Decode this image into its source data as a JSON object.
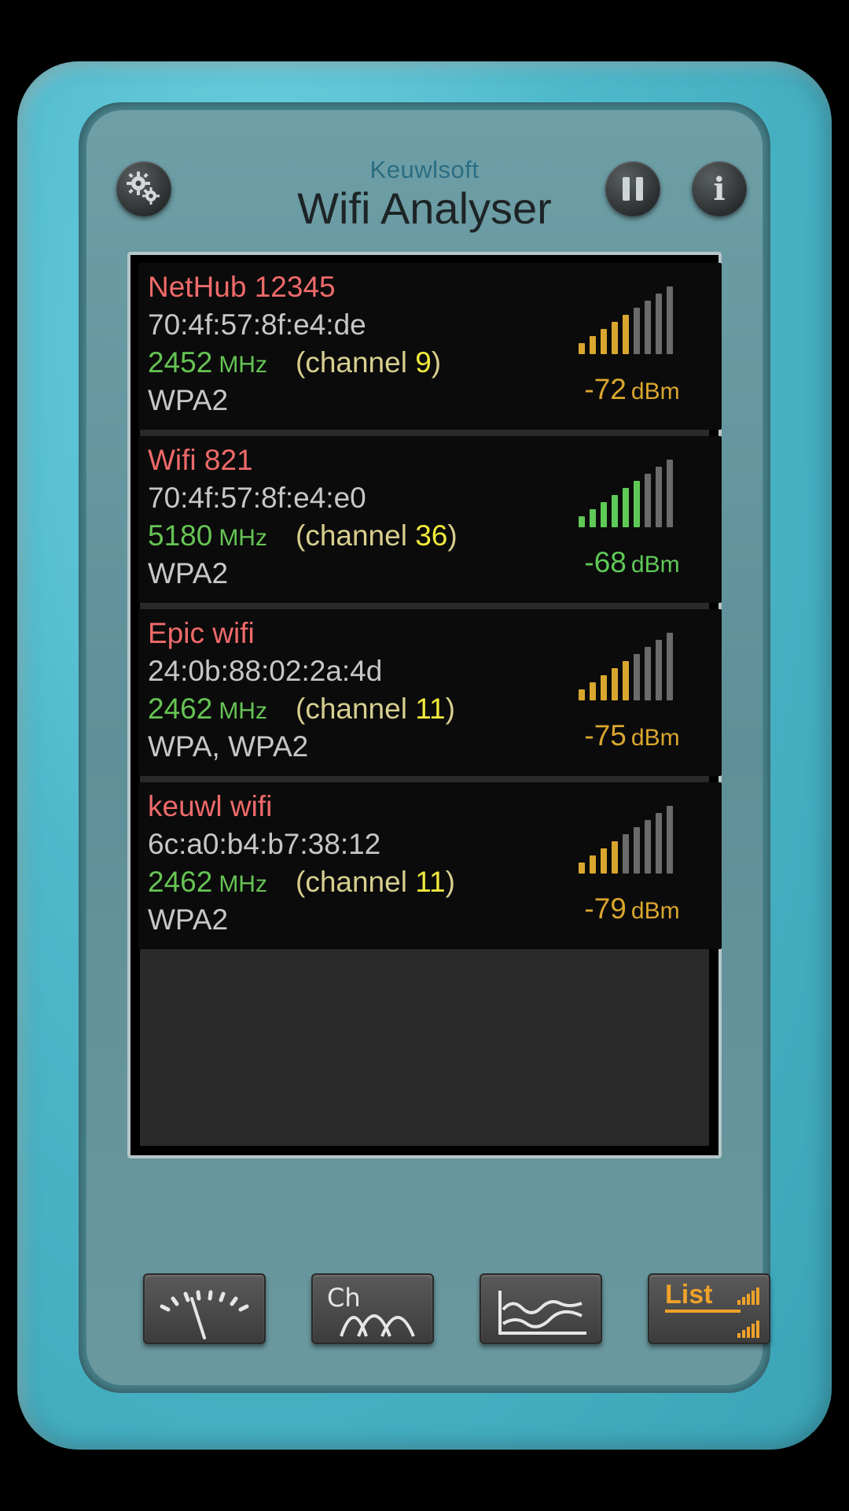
{
  "header": {
    "brand": "Keuwlsoft",
    "title": "Wifi Analyser",
    "settings_icon": "gears-icon",
    "pause_icon": "pause-icon",
    "info_label": "i"
  },
  "networks": [
    {
      "ssid": "NetHub 12345",
      "mac": "70:4f:57:8f:e4:de",
      "frequency": "2452",
      "frequency_unit": "MHz",
      "channel_prefix": "(channel ",
      "channel": "9",
      "channel_suffix": ")",
      "security": "WPA2",
      "signal_dbm": "-72",
      "dbm_unit": "dBm",
      "signal_level": 5,
      "signal_color": "#d9a62e"
    },
    {
      "ssid": "Wifi 821",
      "mac": "70:4f:57:8f:e4:e0",
      "frequency": "5180",
      "frequency_unit": "MHz",
      "channel_prefix": "(channel ",
      "channel": "36",
      "channel_suffix": ")",
      "security": "WPA2",
      "signal_dbm": "-68",
      "dbm_unit": "dBm",
      "signal_level": 6,
      "signal_color": "#5fc957"
    },
    {
      "ssid": "Epic wifi",
      "mac": "24:0b:88:02:2a:4d",
      "frequency": "2462",
      "frequency_unit": "MHz",
      "channel_prefix": "(channel ",
      "channel": "11",
      "channel_suffix": ")",
      "security": "WPA, WPA2",
      "signal_dbm": "-75",
      "dbm_unit": "dBm",
      "signal_level": 5,
      "signal_color": "#d9a62e"
    },
    {
      "ssid": "keuwl wifi",
      "mac": "6c:a0:b4:b7:38:12",
      "frequency": "2462",
      "frequency_unit": "MHz",
      "channel_prefix": "(channel ",
      "channel": "11",
      "channel_suffix": ")",
      "security": "WPA2",
      "signal_dbm": "-79",
      "dbm_unit": "dBm",
      "signal_level": 4,
      "signal_color": "#d9a62e"
    }
  ],
  "signal_bar_total": 9,
  "inactive_bar_color": "#6b6b6b",
  "tabs": [
    {
      "id": "gauge",
      "icon": "signal-meter-icon"
    },
    {
      "id": "channel",
      "label": "Ch",
      "icon": "channel-graph-icon"
    },
    {
      "id": "time",
      "icon": "time-graph-icon"
    },
    {
      "id": "list",
      "label": "List",
      "icon": "list-signal-icon",
      "active": true,
      "active_color": "#f0a22a"
    }
  ]
}
